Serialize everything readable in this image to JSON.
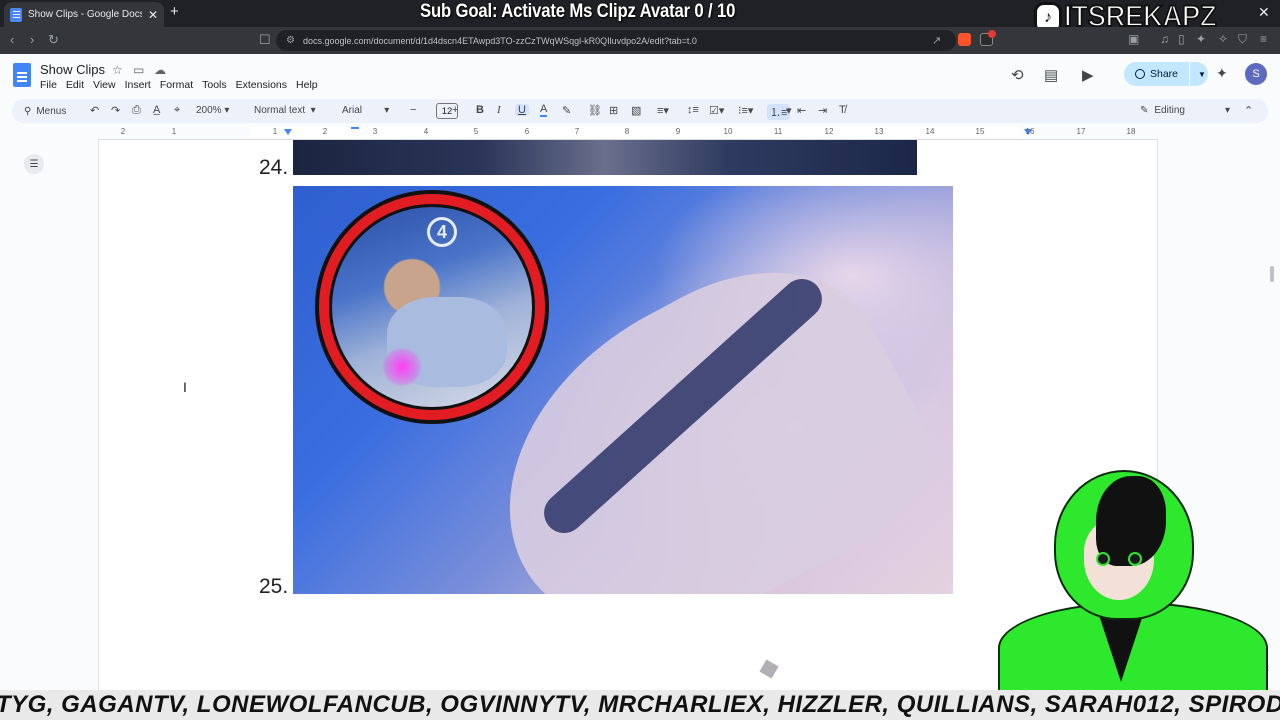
{
  "browser": {
    "tab_title": "Show Clips - Google Docs",
    "url": "docs.google.com/document/d/1d4dscn4ETAwpd3TO-zzCzTWqWSqgl-kR0QIluvdpo2A/edit?tab=t.0"
  },
  "overlay": {
    "sub_goal": "Sub Goal: Activate Ms Clipz Avatar  0 / 10",
    "brand": "ITSREKAPZ",
    "tiktok_glyph": "♪",
    "ticker": "TYG, GAGANTV, LONEWOLFANCUB, OGVINNYTV, MRCHARLIEX, HIZZLER, QUILLIANS, SARAH012, SPIROD"
  },
  "docs": {
    "title": "Show Clips",
    "menu": [
      "File",
      "Edit",
      "View",
      "Insert",
      "Format",
      "Tools",
      "Extensions",
      "Help"
    ],
    "share_label": "Share",
    "avatar_initial": "S",
    "toolbar": {
      "search_label": "Menus",
      "zoom": "200%",
      "style": "Normal text",
      "font": "Arial",
      "font_size": "12",
      "mode": "Editing"
    },
    "ruler_numbers": [
      "2",
      "1",
      "1",
      "2",
      "3",
      "4",
      "5",
      "6",
      "7",
      "8",
      "9",
      "10",
      "11",
      "12",
      "13",
      "14",
      "15",
      "16",
      "17",
      "18"
    ],
    "list_items": [
      "24.",
      "25."
    ],
    "circle_number": "4"
  },
  "icons": {
    "accent": "#4285f4",
    "share_bg": "#c2e7ff",
    "frame_red": "#e11d23",
    "avatar_green": "#2ee82e"
  }
}
